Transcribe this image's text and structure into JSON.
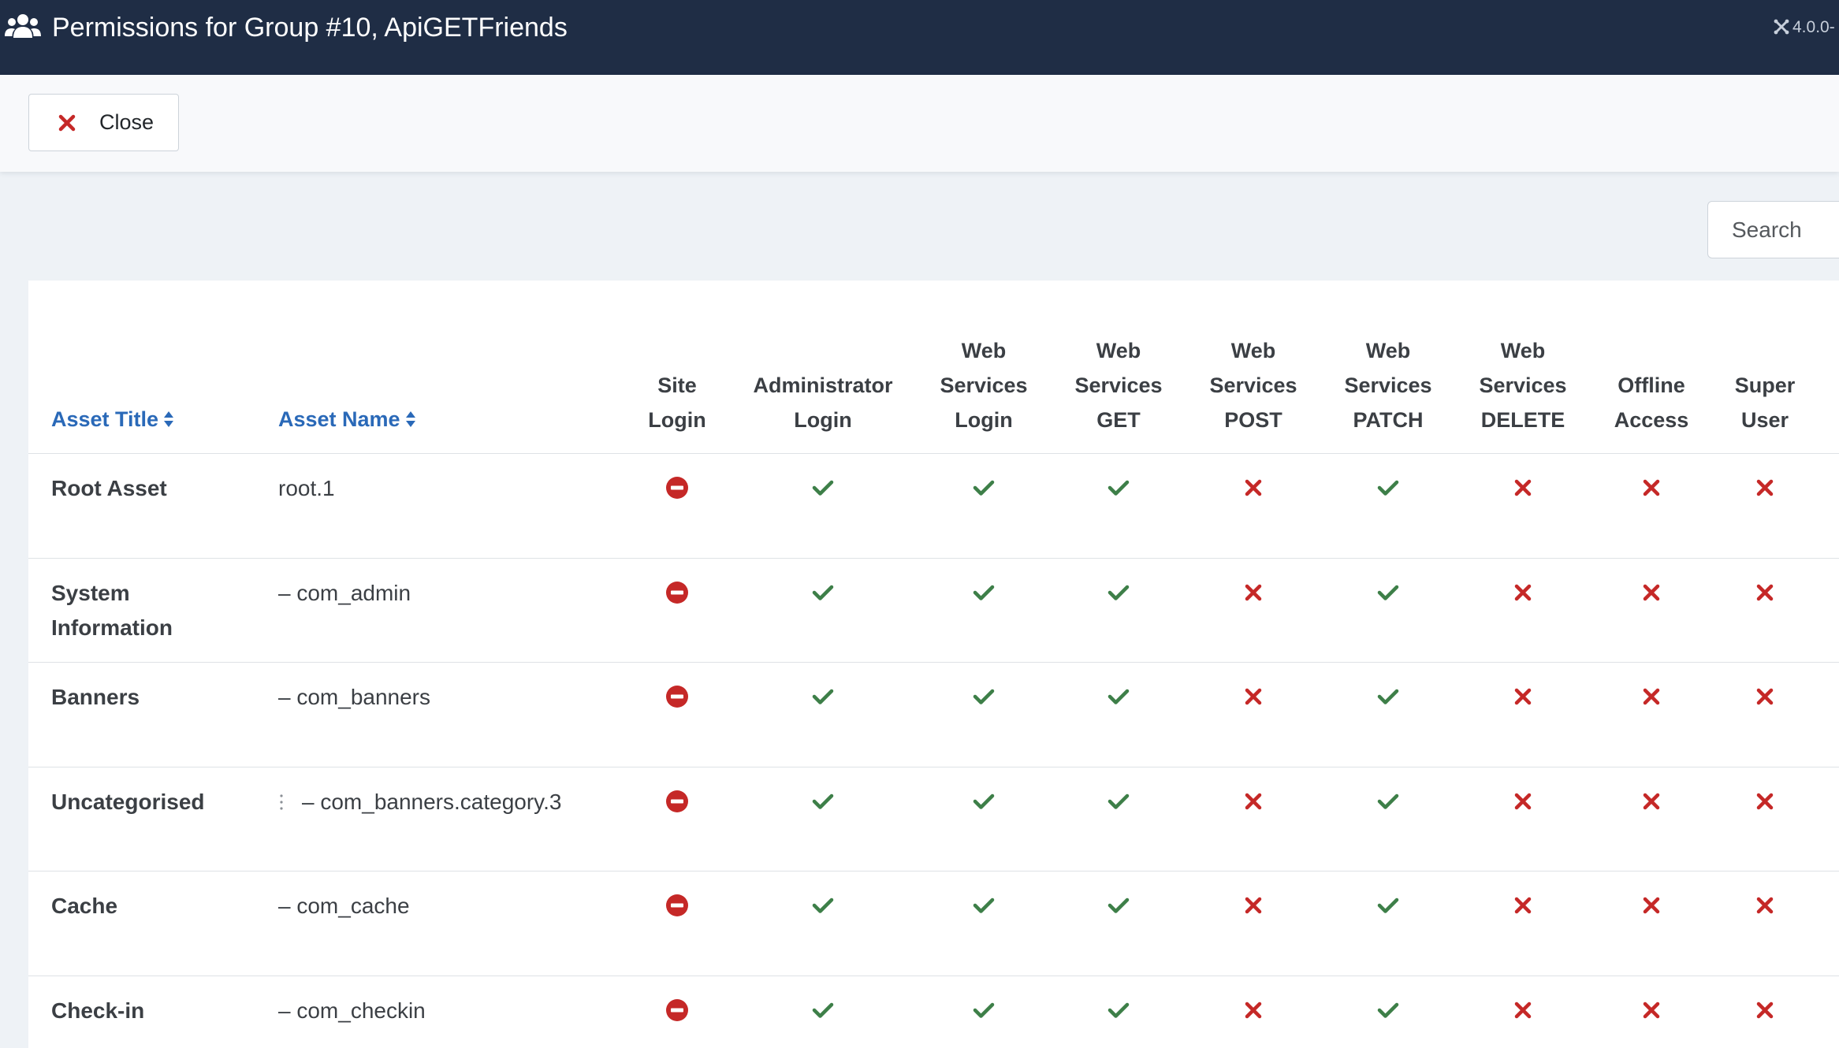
{
  "header": {
    "title": "Permissions for Group #10, ApiGETFriends",
    "version": "4.0.0-"
  },
  "toolbar": {
    "close_label": "Close"
  },
  "search": {
    "placeholder": "Search"
  },
  "colors": {
    "header_bg": "#1f2d45",
    "link": "#2a69b8",
    "allowed": "#3d7f48",
    "denied": "#c52827"
  },
  "table": {
    "col_asset_title": "Asset Title",
    "col_asset_name": "Asset Name",
    "permission_columns": [
      {
        "lines": [
          "Site",
          "Login"
        ]
      },
      {
        "lines": [
          "Administrator",
          "Login"
        ]
      },
      {
        "lines": [
          "Web",
          "Services",
          "Login"
        ]
      },
      {
        "lines": [
          "Web",
          "Services",
          "GET"
        ]
      },
      {
        "lines": [
          "Web",
          "Services",
          "POST"
        ]
      },
      {
        "lines": [
          "Web",
          "Services",
          "PATCH"
        ]
      },
      {
        "lines": [
          "Web",
          "Services",
          "DELETE"
        ]
      },
      {
        "lines": [
          "Offline",
          "Access"
        ]
      },
      {
        "lines": [
          "Super",
          "User"
        ]
      }
    ],
    "rows": [
      {
        "title": "Root Asset",
        "name": "root.1",
        "level": 0,
        "perms": [
          "blocked",
          "allowed",
          "allowed",
          "allowed",
          "denied",
          "allowed",
          "denied",
          "denied",
          "denied"
        ]
      },
      {
        "title": "System Information",
        "name": "– com_admin",
        "level": 1,
        "perms": [
          "blocked",
          "allowed",
          "allowed",
          "allowed",
          "denied",
          "allowed",
          "denied",
          "denied",
          "denied"
        ]
      },
      {
        "title": "Banners",
        "name": "– com_banners",
        "level": 1,
        "perms": [
          "blocked",
          "allowed",
          "allowed",
          "allowed",
          "denied",
          "allowed",
          "denied",
          "denied",
          "denied"
        ]
      },
      {
        "title": "Uncategorised",
        "name": "– com_banners.category.3",
        "level": 2,
        "perms": [
          "blocked",
          "allowed",
          "allowed",
          "allowed",
          "denied",
          "allowed",
          "denied",
          "denied",
          "denied"
        ]
      },
      {
        "title": "Cache",
        "name": "– com_cache",
        "level": 1,
        "perms": [
          "blocked",
          "allowed",
          "allowed",
          "allowed",
          "denied",
          "allowed",
          "denied",
          "denied",
          "denied"
        ]
      },
      {
        "title": "Check-in",
        "name": "– com_checkin",
        "level": 1,
        "perms": [
          "blocked",
          "allowed",
          "allowed",
          "allowed",
          "denied",
          "allowed",
          "denied",
          "denied",
          "denied"
        ]
      }
    ]
  }
}
